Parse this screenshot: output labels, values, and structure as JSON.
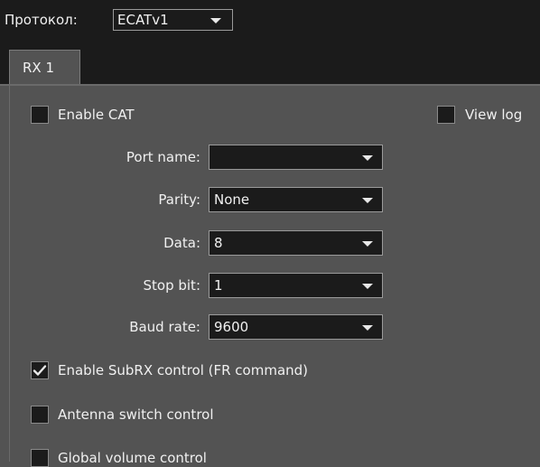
{
  "protocol": {
    "label": "Протокол:",
    "value": "ECATv1"
  },
  "tabs": [
    {
      "label": "RX 1"
    }
  ],
  "enable_cat": {
    "label": "Enable CAT",
    "checked": false
  },
  "view_log": {
    "label": "View log",
    "checked": false
  },
  "fields": {
    "port_name": {
      "label": "Port name:",
      "value": ""
    },
    "parity": {
      "label": "Parity:",
      "value": "None"
    },
    "data": {
      "label": "Data:",
      "value": "8"
    },
    "stop_bit": {
      "label": "Stop bit:",
      "value": "1"
    },
    "baud_rate": {
      "label": "Baud rate:",
      "value": "9600"
    }
  },
  "options": {
    "subrx": {
      "label": "Enable SubRX control (FR command)",
      "checked": true
    },
    "antenna": {
      "label": "Antenna switch control",
      "checked": false
    },
    "global_volume": {
      "label": "Global volume control",
      "checked": false
    }
  },
  "colors": {
    "background": "#535353",
    "dark": "#1b1b1b",
    "border": "#9a9a9a"
  }
}
